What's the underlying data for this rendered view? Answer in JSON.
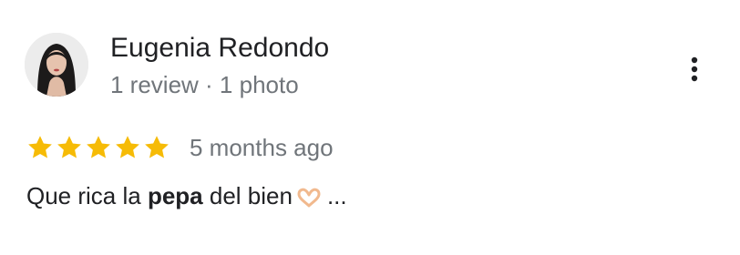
{
  "reviewer": {
    "name": "Eugenia Redondo",
    "meta": "1 review · 1 photo"
  },
  "review": {
    "rating": 5,
    "max_rating": 5,
    "time": "5 months ago",
    "text_before": "Que rica la ",
    "text_bold": "pepa",
    "text_after": " del bien",
    "emoji": "heart-hands-emoji",
    "ellipsis": "..."
  },
  "colors": {
    "star": "#f6bb06",
    "name": "#202124",
    "secondary": "#70757a"
  },
  "icons": {
    "more": "more-vert-icon",
    "star": "star-icon"
  }
}
